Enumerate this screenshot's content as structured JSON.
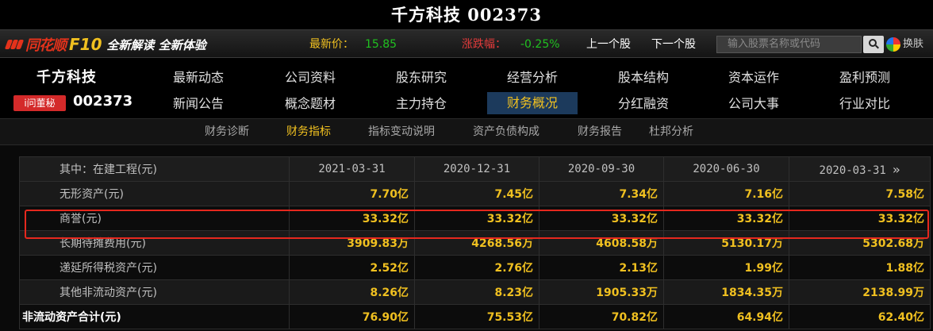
{
  "title": "千方科技 002373",
  "header": {
    "brand": "同花顺",
    "product": "F10",
    "slogan": "全新解读 全新体验",
    "price_label": "最新价：",
    "price_value": "15.85",
    "change_label": "涨跌幅：",
    "change_value": "-0.25%",
    "prev_stock": "上一个股",
    "next_stock": "下一个股",
    "search_placeholder": "输入股票名称或代码",
    "skin_label": "换肤",
    "colors": {
      "brand_red": "#e4321b",
      "accent_yellow": "#f0c020",
      "up_green": "#20c020",
      "down_red": "#e33b3b"
    }
  },
  "stock": {
    "name": "千方科技",
    "code": "002373",
    "badge": "i问董秘"
  },
  "main_nav": {
    "row1": [
      "最新动态",
      "公司资料",
      "股东研究",
      "经营分析",
      "股本结构",
      "资本运作",
      "盈利预测"
    ],
    "row2": [
      "新闻公告",
      "概念题材",
      "主力持仓",
      "财务概况",
      "分红融资",
      "公司大事",
      "行业对比"
    ],
    "active": "财务概况"
  },
  "sub_nav": {
    "items": [
      "财务诊断",
      "财务指标",
      "指标变动说明",
      "资产负债构成",
      "财务报告",
      "杜邦分析"
    ],
    "active": "财务指标"
  },
  "table": {
    "header_label": "其中：在建工程(元)",
    "columns": [
      "2021-03-31",
      "2020-12-31",
      "2020-09-30",
      "2020-06-30",
      "2020-03-31"
    ],
    "next_icon": "»",
    "rows": [
      {
        "label": "无形资产(元)",
        "values": [
          "7.70亿",
          "7.45亿",
          "7.34亿",
          "7.16亿",
          "7.58亿"
        ]
      },
      {
        "label": "商誉(元)",
        "values": [
          "33.32亿",
          "33.32亿",
          "33.32亿",
          "33.32亿",
          "33.32亿"
        ],
        "highlighted": true
      },
      {
        "label": "长期待摊费用(元)",
        "values": [
          "3909.83万",
          "4268.56万",
          "4608.58万",
          "5130.17万",
          "5302.68万"
        ]
      },
      {
        "label": "递延所得税资产(元)",
        "values": [
          "2.52亿",
          "2.76亿",
          "2.13亿",
          "1.99亿",
          "1.88亿"
        ]
      },
      {
        "label": "其他非流动资产(元)",
        "values": [
          "8.26亿",
          "8.23亿",
          "1905.33万",
          "1834.35万",
          "2138.99万"
        ]
      },
      {
        "label": "非流动资产合计(元)",
        "values": [
          "76.90亿",
          "75.53亿",
          "70.82亿",
          "64.94亿",
          "62.40亿"
        ]
      }
    ]
  }
}
